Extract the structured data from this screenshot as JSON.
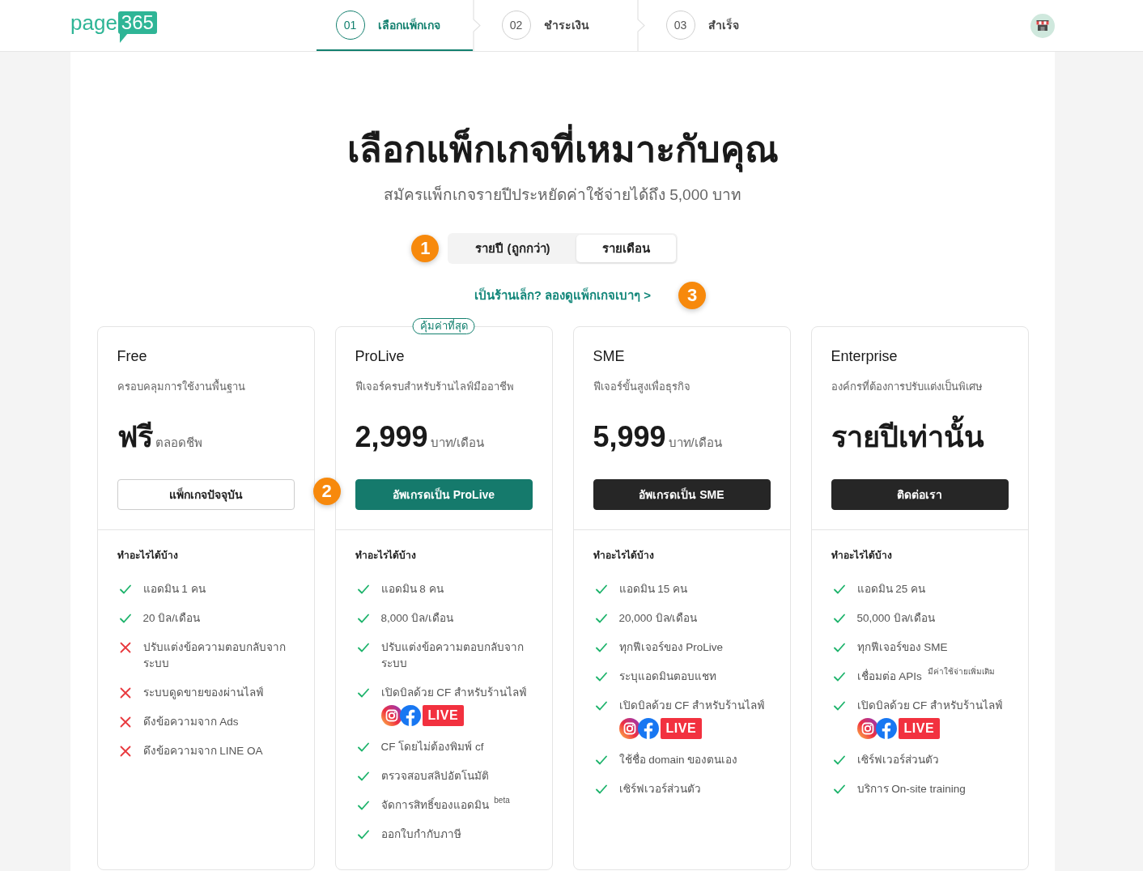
{
  "header": {
    "logo": {
      "text": "page",
      "badge": "365"
    },
    "steps": [
      {
        "number": "01",
        "label": "เลือกแพ็กเกจ",
        "selected": true
      },
      {
        "number": "02",
        "label": "ชำระเงิน",
        "selected": false
      },
      {
        "number": "03",
        "label": "สำเร็จ",
        "selected": false
      }
    ]
  },
  "title": "เลือกแพ็กเกจที่เหมาะกับคุณ",
  "subtitle": "สมัครแพ็กเกจรายปีประหยัดค่าใช้จ่ายได้ถึง 5,000 บาท",
  "billing_toggle": {
    "marker": "1",
    "options": [
      {
        "label": "รายปี (ถูกกว่า)",
        "selected": false
      },
      {
        "label": "รายเดือน",
        "selected": true
      }
    ]
  },
  "small_shop_link": {
    "text": "เป็นร้านเล็ก? ลองดูแพ็กเกจเบาๆ >",
    "marker": "3"
  },
  "plans": [
    {
      "name": "Free",
      "description": "ครอบคลุมการใช้งานพื้นฐาน",
      "price": "ฟรี",
      "unit": "ตลอดชีพ",
      "button": {
        "label": "แพ็กเกจปัจจุบัน",
        "kind": "outline"
      },
      "features_title": "ทำอะไรได้บ้าง",
      "features": [
        {
          "text": "แอดมิน 1 คน",
          "included": true
        },
        {
          "text": "20 บิล/เดือน",
          "included": true
        },
        {
          "text": "ปรับแต่งข้อความตอบกลับจากระบบ",
          "included": false
        },
        {
          "text": "ระบบดูดขายของผ่านไลฟ์",
          "included": false
        },
        {
          "text": "ดึงข้อความจาก Ads",
          "included": false
        },
        {
          "text": "ดึงข้อความจาก LINE OA",
          "included": false
        }
      ]
    },
    {
      "badge": "คุ้มค่าที่สุด",
      "name": "ProLive",
      "description": "ฟีเจอร์ครบสำหรับร้านไลฟ์มืออาชีพ",
      "price": "2,999",
      "unit": "บาท/เดือน",
      "button": {
        "label": "อัพเกรดเป็น ProLive",
        "kind": "primary",
        "marker": "2"
      },
      "features_title": "ทำอะไรได้บ้าง",
      "features": [
        {
          "text": "แอดมิน 8 คน",
          "included": true
        },
        {
          "text": "8,000 บิล/เดือน",
          "included": true
        },
        {
          "text": "ปรับแต่งข้อความตอบกลับจากระบบ",
          "included": true
        },
        {
          "text": "เปิดบิลด้วย CF สำหรับร้านไลฟ์",
          "included": true,
          "live_badge": "LIVE"
        },
        {
          "text": "CF โดยไม่ต้องพิมพ์ cf",
          "included": true
        },
        {
          "text": "ตรวจสอบสลิปอัตโนมัติ",
          "included": true
        },
        {
          "text": "จัดการสิทธิ์ของแอดมิน $^{beta}$",
          "included": true
        },
        {
          "text": "ออกใบกำกับภาษี",
          "included": true
        }
      ]
    },
    {
      "name": "SME",
      "description": "ฟีเจอร์ขั้นสูงเพื่อธุรกิจ",
      "price": "5,999",
      "unit": "บาท/เดือน",
      "button": {
        "label": "อัพเกรดเป็น SME",
        "kind": "dark"
      },
      "features_title": "ทำอะไรได้บ้าง",
      "features": [
        {
          "text": "แอดมิน 15 คน",
          "included": true
        },
        {
          "text": "20,000 บิล/เดือน",
          "included": true
        },
        {
          "text": "ทุกฟีเจอร์ของ ProLive",
          "included": true
        },
        {
          "text": "ระบุแอดมินตอบแชท",
          "included": true
        },
        {
          "text": "เปิดบิลด้วย CF สำหรับร้านไลฟ์",
          "included": true,
          "live_badge": "LIVE"
        },
        {
          "text": "ใช้ชื่อ domain ของตนเอง",
          "included": true
        },
        {
          "text": "เซิร์ฟเวอร์ส่วนตัว",
          "included": true
        }
      ]
    },
    {
      "name": "Enterprise",
      "description": "องค์กรที่ต้องการปรับแต่งเป็นพิเศษ",
      "price": "รายปีเท่านั้น",
      "button": {
        "label": "ติดต่อเรา",
        "kind": "dark"
      },
      "features_title": "ทำอะไรได้บ้าง",
      "features": [
        {
          "text": "แอดมิน 25 คน",
          "included": true
        },
        {
          "text": "50,000 บิล/เดือน",
          "included": true
        },
        {
          "text": "ทุกฟีเจอร์ของ SME",
          "included": true
        },
        {
          "text": "เชื่อมต่อ APIs $^{มีค่าใช้จ่ายเพิ่มเติม}$",
          "included": true
        },
        {
          "text": "เปิดบิลด้วย CF สำหรับร้านไลฟ์",
          "included": true,
          "live_badge": "LIVE"
        },
        {
          "text": "เซิร์ฟเวอร์ส่วนตัว",
          "included": true
        },
        {
          "text": "บริการ On-site training",
          "included": true
        }
      ]
    }
  ]
}
